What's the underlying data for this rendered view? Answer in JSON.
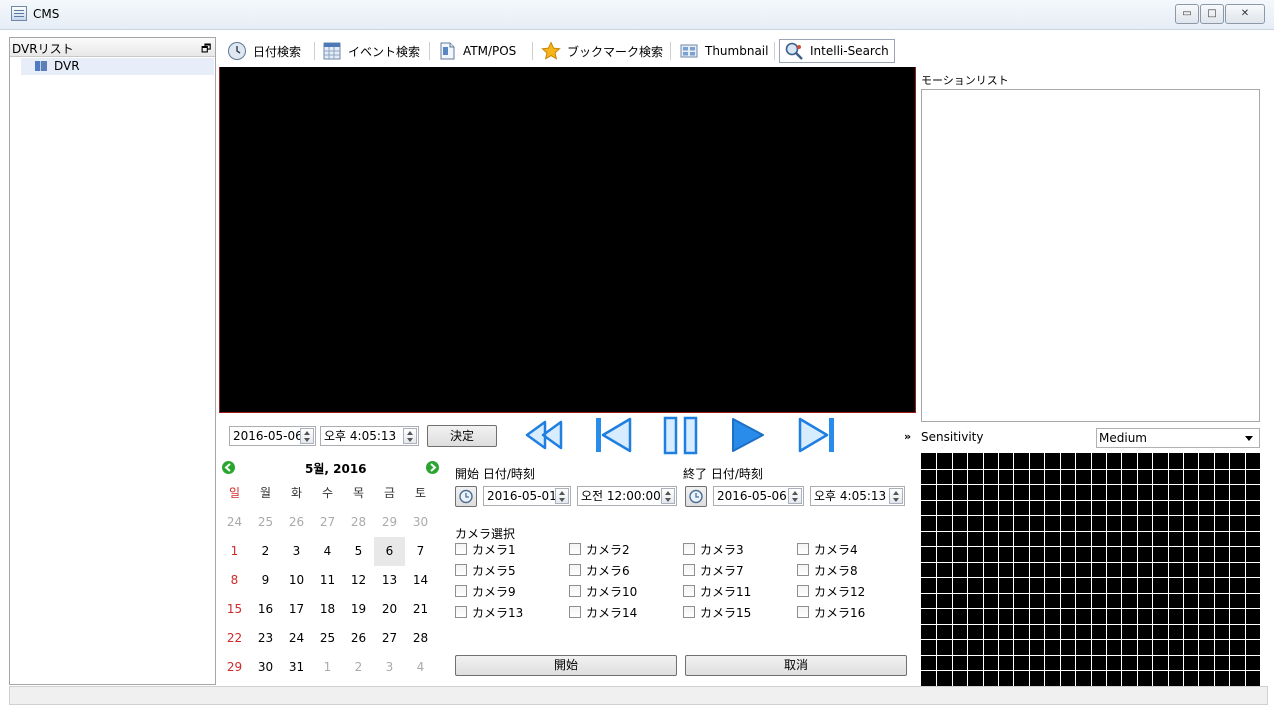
{
  "window": {
    "title": "CMS"
  },
  "left_panel": {
    "header": "DVRリスト",
    "tree": [
      {
        "label": "DVR"
      }
    ]
  },
  "toolbar": {
    "items": [
      {
        "label": "日付検索"
      },
      {
        "label": "イベント検索"
      },
      {
        "label": "ATM/POS"
      },
      {
        "label": "ブックマーク検索"
      },
      {
        "label": "Thumbnail"
      },
      {
        "label": "Intelli-Search"
      }
    ]
  },
  "playback": {
    "date": "2016-05-06",
    "time": "오후 4:05:13",
    "confirm_label": "決定",
    "expand_glyph": "»"
  },
  "calendar": {
    "month_label": "5월, 2016",
    "weekdays": [
      "일",
      "월",
      "화",
      "수",
      "목",
      "금",
      "토"
    ],
    "weeks": [
      [
        "24",
        "25",
        "26",
        "27",
        "28",
        "29",
        "30"
      ],
      [
        "1",
        "2",
        "3",
        "4",
        "5",
        "6",
        "7"
      ],
      [
        "8",
        "9",
        "10",
        "11",
        "12",
        "13",
        "14"
      ],
      [
        "15",
        "16",
        "17",
        "18",
        "19",
        "20",
        "21"
      ],
      [
        "22",
        "23",
        "24",
        "25",
        "26",
        "27",
        "28"
      ],
      [
        "29",
        "30",
        "31",
        "1",
        "2",
        "3",
        "4"
      ]
    ]
  },
  "search": {
    "start_label": "開始 日付/時刻",
    "start_date": "2016-05-01",
    "start_time": "오전 12:00:00",
    "end_label": "終了 日付/時刻",
    "end_date": "2016-05-06",
    "end_time": "오후 4:05:13",
    "camera_section_label": "カメラ選択",
    "cameras": [
      "カメラ1",
      "カメラ2",
      "カメラ3",
      "カメラ4",
      "カメラ5",
      "カメラ6",
      "カメラ7",
      "カメラ8",
      "カメラ9",
      "カメラ10",
      "カメラ11",
      "カメラ12",
      "カメラ13",
      "カメラ14",
      "カメラ15",
      "カメラ16"
    ],
    "start_button": "開始",
    "cancel_button": "取消"
  },
  "motion": {
    "list_label": "モーションリスト",
    "sensitivity_label": "Sensitivity",
    "sensitivity_value": "Medium"
  },
  "colors": {
    "video_border": "#9b1b1b",
    "calendar_red": "#d02a2a",
    "play_blue": "#1e7fe0",
    "nav_green": "#2aa630"
  }
}
